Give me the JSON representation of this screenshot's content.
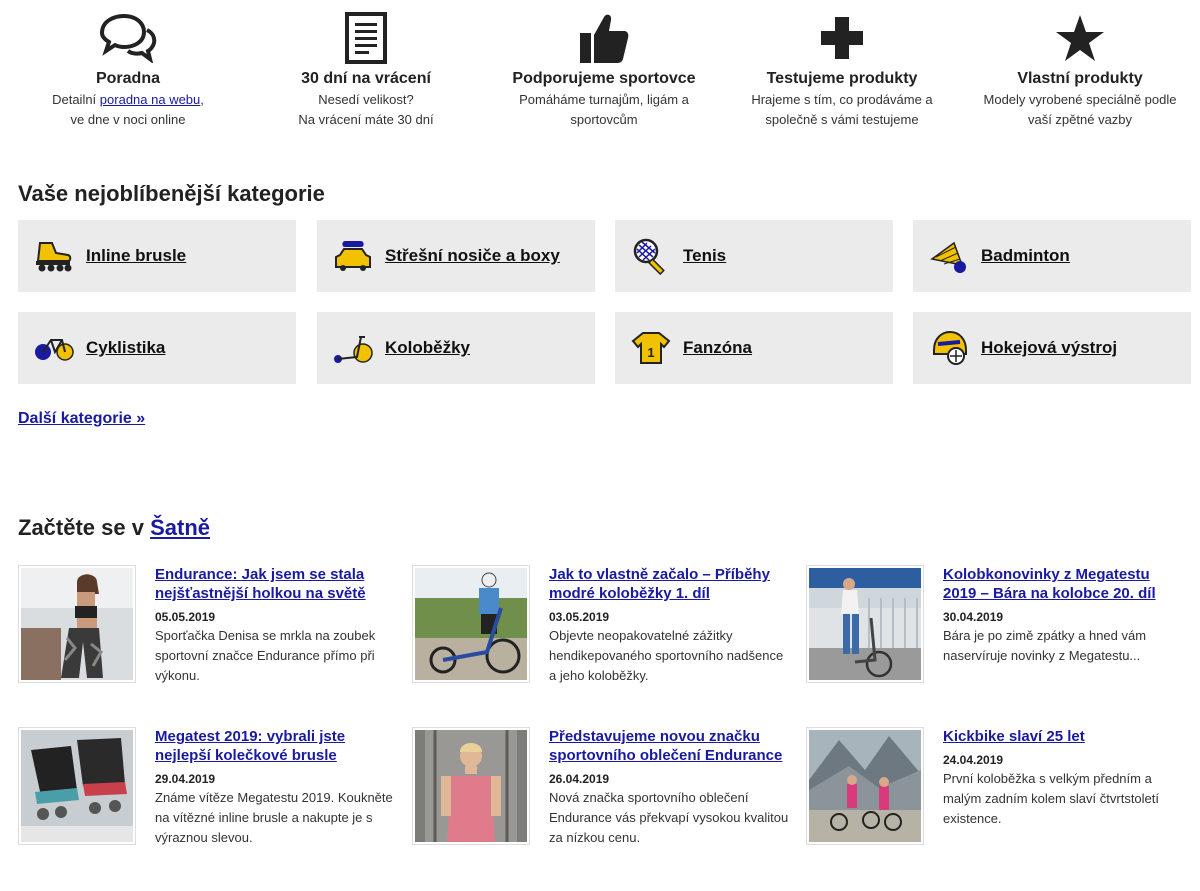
{
  "features": [
    {
      "icon": "speech-bubbles-icon",
      "title": "Poradna",
      "desc_pre": "Detailní ",
      "desc_link": "poradna na webu",
      "desc_post": ",",
      "desc_line2": "ve dne v noci online"
    },
    {
      "icon": "document-icon",
      "title": "30 dní na vrácení",
      "desc_pre": "Nesedí velikost?",
      "desc_link": "",
      "desc_post": "",
      "desc_line2": "Na vrácení máte 30 dní"
    },
    {
      "icon": "thumbs-up-icon",
      "title": "Podporujeme sportovce",
      "desc_pre": "Pomáháme turnajům, ligám a",
      "desc_link": "",
      "desc_post": "",
      "desc_line2": "sportovcům"
    },
    {
      "icon": "plus-icon",
      "title": "Testujeme produkty",
      "desc_pre": "Hrajeme s tím, co prodáváme a",
      "desc_link": "",
      "desc_post": "",
      "desc_line2": "společně s vámi testujeme"
    },
    {
      "icon": "star-icon",
      "title": "Vlastní produkty",
      "desc_pre": "Modely vyrobené speciálně podle",
      "desc_link": "",
      "desc_post": "",
      "desc_line2": "vaší zpětné vazby"
    }
  ],
  "categories_heading": "Vaše nejoblíbenější kategorie",
  "categories": [
    {
      "label": "Inline brusle",
      "icon": "inline-skate-icon"
    },
    {
      "label": "Střešní nosiče a boxy",
      "icon": "roof-box-car-icon"
    },
    {
      "label": "Tenis",
      "icon": "tennis-racket-icon"
    },
    {
      "label": "Badminton",
      "icon": "shuttlecock-icon"
    },
    {
      "label": "Cyklistika",
      "icon": "bicycle-icon"
    },
    {
      "label": "Koloběžky",
      "icon": "scooter-icon"
    },
    {
      "label": "Fanzóna",
      "icon": "jersey-icon"
    },
    {
      "label": "Hokejová výstroj",
      "icon": "hockey-helmet-icon"
    }
  ],
  "more_categories": "Další kategorie »",
  "read_heading_pre": "Začtěte se v ",
  "read_heading_link": "Šatně",
  "articles": [
    {
      "title": "Endurance: Jak jsem se stala nejšťastnější holkou na světě",
      "date": "05.05.2019",
      "text": "Sporťačka Denisa se mrkla na zoubek sportovní značce Endurance přímo při výkonu."
    },
    {
      "title": "Jak to vlastně začalo – Příběhy modré koloběžky 1. díl",
      "date": "03.05.2019",
      "text": "Objevte neopakovatelné zážitky hendikepovaného sportovního nadšence a jeho koloběžky."
    },
    {
      "title": "Kolobkonovinky z Megatestu 2019 – Bára na kolobce 20. díl",
      "date": "30.04.2019",
      "text": "Bára je po zimě zpátky a hned vám naservíruje novinky z Megatestu..."
    },
    {
      "title": "Megatest 2019: vybrali jste nejlepší kolečkové brusle",
      "date": "29.04.2019",
      "text": "Známe vítěze Megatestu 2019. Koukněte na vítězné inline brusle a nakupte je s výraznou slevou."
    },
    {
      "title": "Představujeme novou značku sportovního oblečení Endurance",
      "date": "26.04.2019",
      "text": "Nová značka sportovního oblečení Endurance vás překvapí vysokou kvalitou za nízkou cenu."
    },
    {
      "title": "Kickbike slaví 25 let",
      "date": "24.04.2019",
      "text": "První koloběžka s velkým předním a malým zadním kolem slaví čtvrtstoletí existence."
    }
  ],
  "colors": {
    "accent_yellow": "#f2c200",
    "accent_blue": "#1a1aa0",
    "tile_bg": "#ebebeb"
  }
}
